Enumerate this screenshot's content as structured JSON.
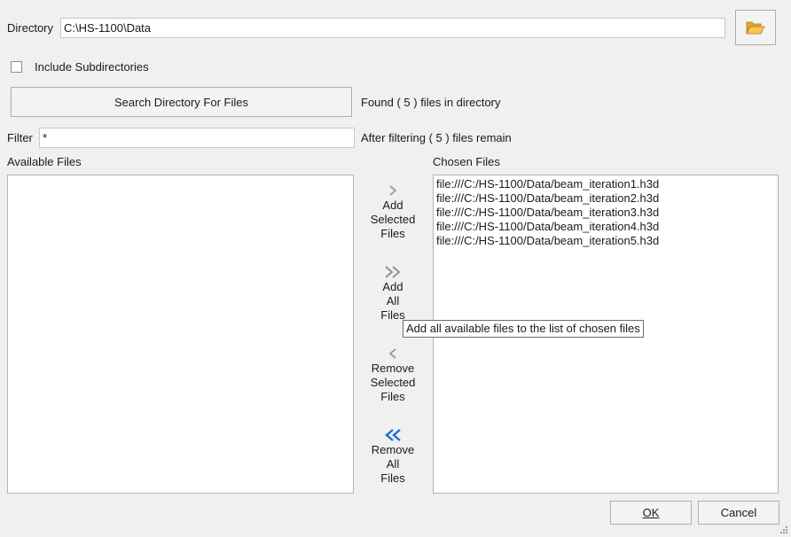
{
  "directory": {
    "label": "Directory",
    "value": "C:\\HS-1100\\Data",
    "browse_icon": "folder-open-icon"
  },
  "include_subdirs": {
    "label": "Include Subdirectories",
    "checked": false
  },
  "search": {
    "button_label": "Search Directory For Files",
    "status": "Found ( 5 ) files in directory"
  },
  "filter": {
    "label": "Filter",
    "value": "*",
    "status": "After filtering ( 5 ) files remain"
  },
  "available": {
    "header": "Available Files",
    "items": []
  },
  "chosen": {
    "header": "Chosen Files",
    "items": [
      "file:///C:/HS-1100/Data/beam_iteration1.h3d",
      "file:///C:/HS-1100/Data/beam_iteration2.h3d",
      "file:///C:/HS-1100/Data/beam_iteration3.h3d",
      "file:///C:/HS-1100/Data/beam_iteration4.h3d",
      "file:///C:/HS-1100/Data/beam_iteration5.h3d"
    ]
  },
  "transfer": {
    "add_selected": {
      "icon": "chevron-right-icon",
      "lines": [
        "Add",
        "Selected",
        "Files"
      ]
    },
    "add_all": {
      "icon": "double-chevron-right-icon",
      "lines": [
        "Add",
        "All",
        "Files"
      ]
    },
    "remove_selected": {
      "icon": "chevron-left-icon",
      "lines": [
        "Remove",
        "Selected",
        "Files"
      ]
    },
    "remove_all": {
      "icon": "double-chevron-left-icon",
      "lines": [
        "Remove",
        "All",
        "Files"
      ]
    }
  },
  "tooltip": "Add all available files to the list of chosen files",
  "footer": {
    "ok_label": "OK",
    "cancel_label": "Cancel"
  },
  "colors": {
    "accent": "#1f6fd1",
    "disabled_icon": "#9a9a9a",
    "folder": "#e8b53a"
  }
}
